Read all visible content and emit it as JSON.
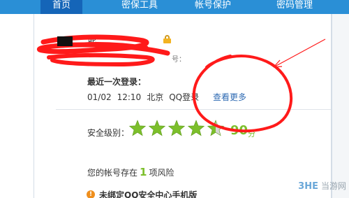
{
  "nav": {
    "tabs": [
      {
        "label": "首页",
        "active": true
      },
      {
        "label": "密保工具",
        "active": false
      },
      {
        "label": "帐号保护",
        "active": false
      },
      {
        "label": "密码管理",
        "active": false
      }
    ],
    "accent": "#2a8fd6"
  },
  "account": {
    "nickname_visible": "昵",
    "tail_visible": "号：",
    "lock_icon": "lock-icon"
  },
  "last_login": {
    "label": "最近一次登录：",
    "date": "01/02",
    "time": "12:10",
    "location": "北京",
    "client": "QQ登录",
    "view_more": "查看更多"
  },
  "security": {
    "label": "安全级别：",
    "stars_filled": 4.5,
    "stars_total": 5,
    "score": "90",
    "score_unit": "分",
    "score_color": "#7cbf2b"
  },
  "risk": {
    "prefix": "您的帐号存在",
    "count": "1",
    "suffix": "项风险"
  },
  "warning": {
    "icon": "warning-icon",
    "text": "未绑定QQ安全中心手机版"
  },
  "watermark": {
    "logo": "3HE",
    "text": "当游网"
  },
  "annotation_colors": {
    "scribble": "#ff1a1a"
  }
}
